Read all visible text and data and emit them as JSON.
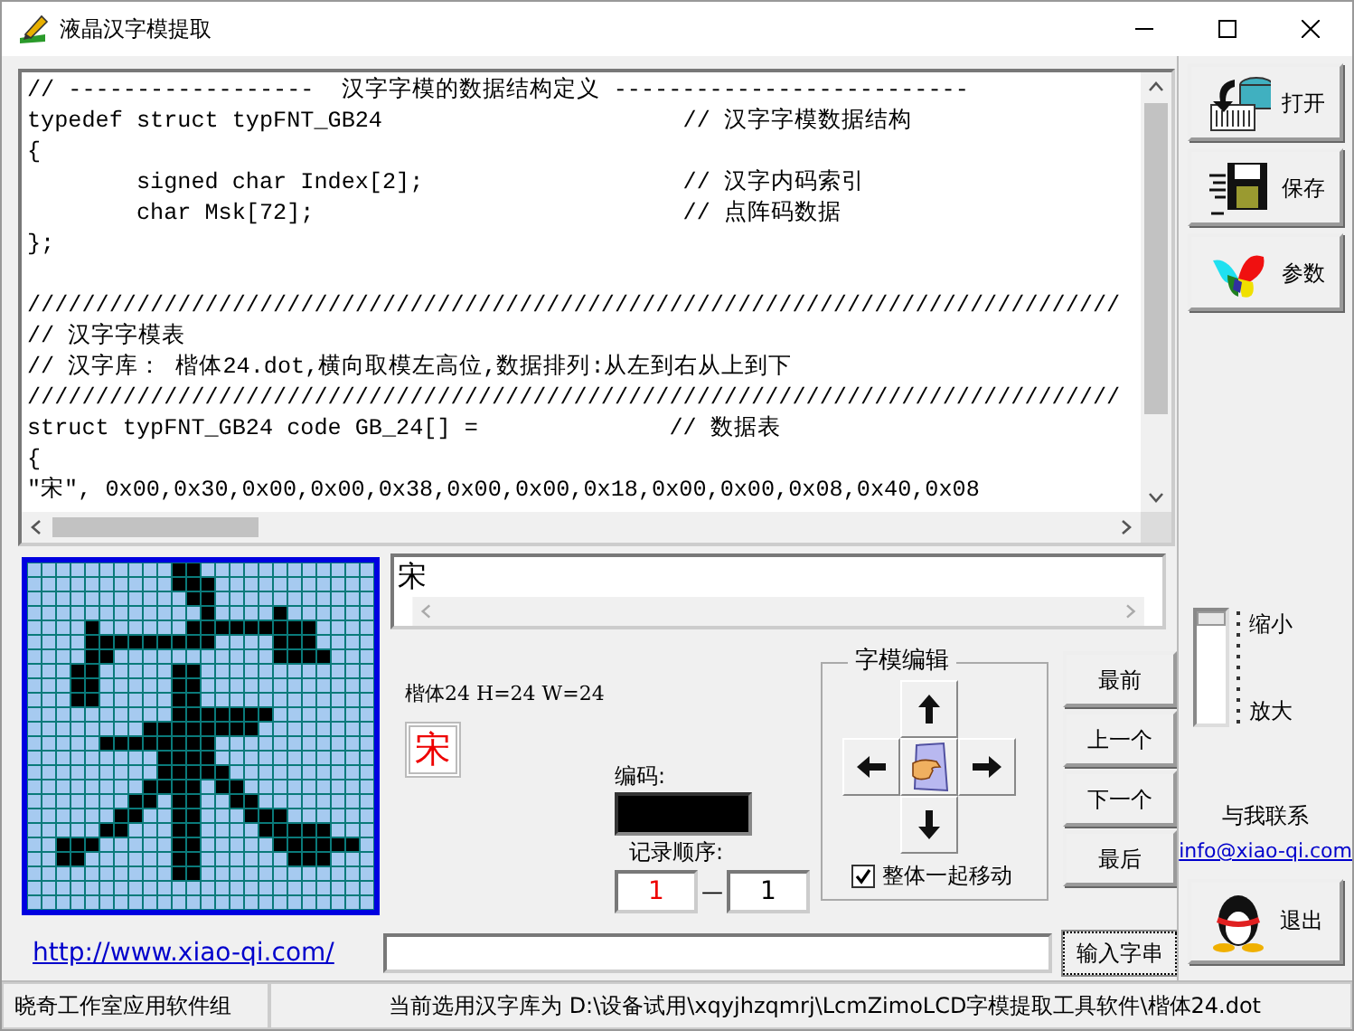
{
  "window": {
    "title": "液晶汉字模提取"
  },
  "code_editor": {
    "blocks": [
      [
        "// ------------------  汉字字模的数据结构定义 --------------------------",
        "typedef struct typFNT_GB24                      // 汉字字模数据结构",
        "{",
        "        signed char Index[2];                   // 汉字内码索引",
        "        char Msk[72];                           // 点阵码数据",
        "};"
      ],
      [
        "////////////////////////////////////////////////////////////////////////////////",
        "// 汉字字模表",
        "// 汉字库： 楷体24.dot,横向取模左高位,数据排列:从左到右从上到下",
        "////////////////////////////////////////////////////////////////////////////////",
        "struct typFNT_GB24 code GB_24[] =              // 数据表",
        "{",
        "\"宋\", 0x00,0x30,0x00,0x00,0x38,0x00,0x00,0x18,0x00,0x00,0x08,0x40,0x08"
      ]
    ]
  },
  "preview": {
    "filled": [
      [
        false,
        false,
        false,
        false,
        false,
        false,
        false,
        false,
        false,
        false,
        true,
        true,
        false,
        false,
        false,
        false,
        false,
        false,
        false,
        false,
        false,
        false,
        false,
        false
      ],
      [
        false,
        false,
        false,
        false,
        false,
        false,
        false,
        false,
        false,
        false,
        true,
        true,
        true,
        false,
        false,
        false,
        false,
        false,
        false,
        false,
        false,
        false,
        false,
        false
      ],
      [
        false,
        false,
        false,
        false,
        false,
        false,
        false,
        false,
        false,
        false,
        false,
        true,
        true,
        false,
        false,
        false,
        false,
        false,
        false,
        false,
        false,
        false,
        false,
        false
      ],
      [
        false,
        false,
        false,
        false,
        false,
        false,
        false,
        false,
        false,
        false,
        false,
        false,
        true,
        false,
        false,
        false,
        false,
        true,
        false,
        false,
        false,
        false,
        false,
        false
      ],
      [
        false,
        false,
        false,
        false,
        true,
        false,
        false,
        false,
        false,
        false,
        false,
        true,
        true,
        true,
        true,
        true,
        true,
        true,
        true,
        true,
        false,
        false,
        false,
        false
      ],
      [
        false,
        false,
        false,
        false,
        true,
        true,
        true,
        true,
        true,
        true,
        true,
        true,
        true,
        false,
        false,
        false,
        false,
        true,
        true,
        true,
        false,
        false,
        false,
        false
      ],
      [
        false,
        false,
        false,
        false,
        true,
        true,
        false,
        false,
        false,
        false,
        false,
        false,
        false,
        false,
        false,
        false,
        false,
        true,
        true,
        true,
        true,
        false,
        false,
        false
      ],
      [
        false,
        false,
        false,
        true,
        true,
        false,
        false,
        false,
        false,
        false,
        true,
        true,
        false,
        false,
        false,
        false,
        false,
        false,
        false,
        false,
        false,
        false,
        false,
        false
      ],
      [
        false,
        false,
        false,
        true,
        true,
        false,
        false,
        false,
        false,
        false,
        true,
        true,
        false,
        false,
        false,
        false,
        false,
        false,
        false,
        false,
        false,
        false,
        false,
        false
      ],
      [
        false,
        false,
        false,
        true,
        true,
        false,
        false,
        false,
        false,
        false,
        true,
        true,
        false,
        false,
        false,
        false,
        false,
        false,
        false,
        false,
        false,
        false,
        false,
        false
      ],
      [
        false,
        false,
        false,
        false,
        false,
        false,
        false,
        false,
        false,
        false,
        true,
        true,
        true,
        true,
        true,
        true,
        true,
        false,
        false,
        false,
        false,
        false,
        false,
        false
      ],
      [
        false,
        false,
        false,
        false,
        false,
        false,
        false,
        false,
        true,
        true,
        true,
        true,
        true,
        true,
        true,
        true,
        false,
        false,
        false,
        false,
        false,
        false,
        false,
        false
      ],
      [
        false,
        false,
        false,
        false,
        false,
        true,
        true,
        true,
        true,
        true,
        true,
        true,
        true,
        false,
        false,
        false,
        false,
        false,
        false,
        false,
        false,
        false,
        false,
        false
      ],
      [
        false,
        false,
        false,
        false,
        false,
        false,
        false,
        false,
        false,
        true,
        true,
        true,
        true,
        false,
        false,
        false,
        false,
        false,
        false,
        false,
        false,
        false,
        false,
        false
      ],
      [
        false,
        false,
        false,
        false,
        false,
        false,
        false,
        false,
        false,
        true,
        true,
        true,
        true,
        true,
        false,
        false,
        false,
        false,
        false,
        false,
        false,
        false,
        false,
        false
      ],
      [
        false,
        false,
        false,
        false,
        false,
        false,
        false,
        false,
        true,
        true,
        true,
        true,
        false,
        true,
        true,
        false,
        false,
        false,
        false,
        false,
        false,
        false,
        false,
        false
      ],
      [
        false,
        false,
        false,
        false,
        false,
        false,
        false,
        true,
        true,
        false,
        true,
        true,
        false,
        false,
        true,
        true,
        false,
        false,
        false,
        false,
        false,
        false,
        false,
        false
      ],
      [
        false,
        false,
        false,
        false,
        false,
        false,
        true,
        true,
        false,
        false,
        true,
        true,
        false,
        false,
        false,
        true,
        true,
        true,
        false,
        false,
        false,
        false,
        false,
        false
      ],
      [
        false,
        false,
        false,
        false,
        false,
        true,
        true,
        false,
        false,
        false,
        true,
        true,
        false,
        false,
        false,
        false,
        true,
        true,
        true,
        true,
        true,
        false,
        false,
        false
      ],
      [
        false,
        false,
        true,
        true,
        true,
        false,
        false,
        false,
        false,
        false,
        true,
        true,
        false,
        false,
        false,
        false,
        false,
        true,
        true,
        true,
        true,
        true,
        true,
        false
      ],
      [
        false,
        false,
        true,
        true,
        false,
        false,
        false,
        false,
        false,
        false,
        true,
        true,
        false,
        false,
        false,
        false,
        false,
        false,
        true,
        true,
        true,
        false,
        false,
        false
      ],
      [
        false,
        false,
        false,
        false,
        false,
        false,
        false,
        false,
        false,
        false,
        true,
        true,
        false,
        false,
        false,
        false,
        false,
        false,
        false,
        false,
        false,
        false,
        false,
        false
      ],
      [
        false,
        false,
        false,
        false,
        false,
        false,
        false,
        false,
        false,
        false,
        false,
        false,
        false,
        false,
        false,
        false,
        false,
        false,
        false,
        false,
        false,
        false,
        false,
        false
      ],
      [
        false,
        false,
        false,
        false,
        false,
        false,
        false,
        false,
        false,
        false,
        false,
        false,
        false,
        false,
        false,
        false,
        false,
        false,
        false,
        false,
        false,
        false,
        false,
        false
      ]
    ]
  },
  "char_field": {
    "value": "宋"
  },
  "font_info": "楷体24 H=24 W=24",
  "char_preview": "宋",
  "code": {
    "label": "编码:"
  },
  "record_order": {
    "label": "记录顺序:",
    "from": "1",
    "separator": "—",
    "to": "1"
  },
  "editor_group": {
    "title": "字模编辑",
    "move_together": {
      "label": "整体一起移动",
      "checked": true
    }
  },
  "nav_buttons": [
    "最前",
    "上一个",
    "下一个",
    "最后"
  ],
  "side_buttons": [
    {
      "label": "打开",
      "kind": "open"
    },
    {
      "label": "保存",
      "kind": "save"
    },
    {
      "label": "参数",
      "kind": "params"
    }
  ],
  "zoom_slider": {
    "top_label": "缩小",
    "bottom_label": "放大"
  },
  "contact": {
    "label": "与我联系",
    "email": "info@xiao-qi.com"
  },
  "exit_button": {
    "label": "退出"
  },
  "bottom_bar": {
    "link": "http://www.xiao-qi.com/",
    "input_button": "输入字串"
  },
  "status_bar": [
    "晓奇工作室应用软件组",
    "当前选用汉字库为 D:\\设备试用\\xqyjhzqmrj\\LcmZimoLCD字模提取工具软件\\楷体24.dot"
  ]
}
